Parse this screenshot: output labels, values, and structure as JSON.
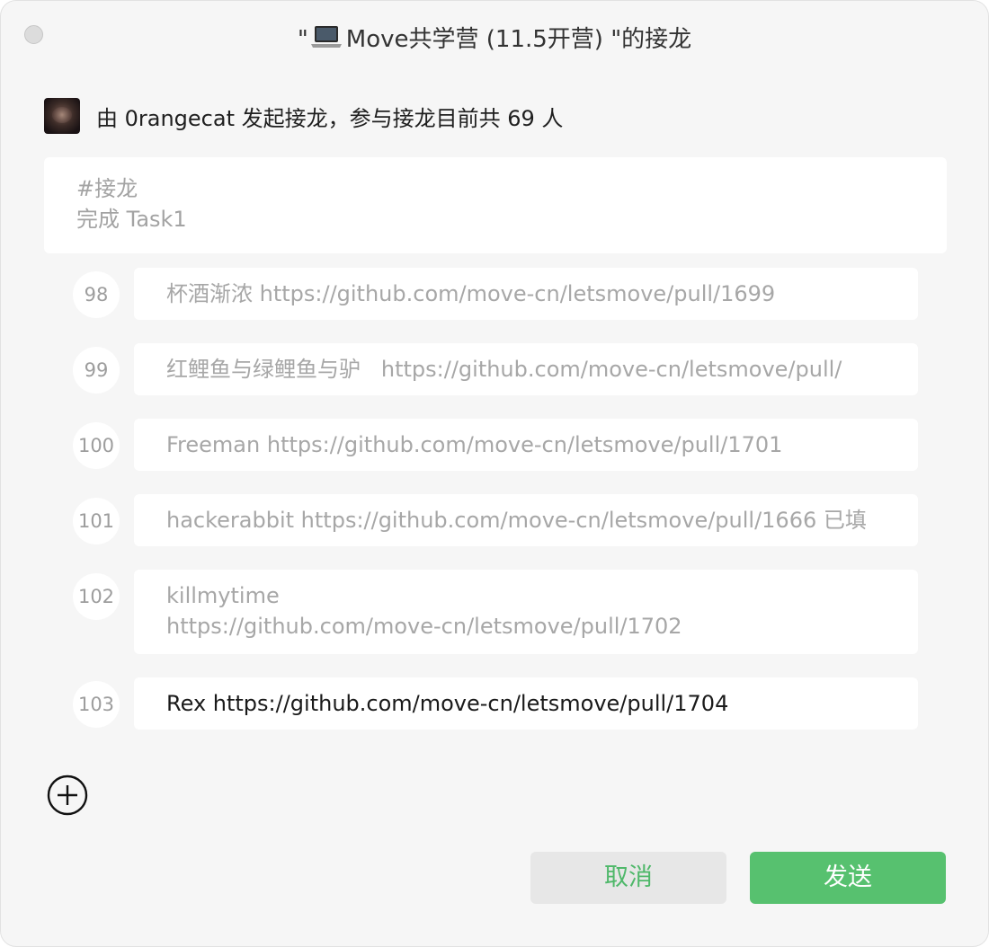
{
  "window": {
    "title_prefix": "\"",
    "title_main": "Move共学营 (11.5开营) \"的接龙"
  },
  "initiator": {
    "text": "由 0rangecat 发起接龙，参与接龙目前共 69 人"
  },
  "header_card": {
    "line1": "#接龙",
    "line2": "完成 Task1"
  },
  "entries": [
    {
      "num": "98",
      "text": "杯酒渐浓 https://github.com/move-cn/letsmove/pull/1699"
    },
    {
      "num": "99",
      "text": "红鲤鱼与绿鲤鱼与驴   https://github.com/move-cn/letsmove/pull/"
    },
    {
      "num": "100",
      "text": "Freeman https://github.com/move-cn/letsmove/pull/1701"
    },
    {
      "num": "101",
      "text": "hackerabbit https://github.com/move-cn/letsmove/pull/1666 已填"
    },
    {
      "num": "102",
      "text": "killmytime\nhttps://github.com/move-cn/letsmove/pull/1702"
    },
    {
      "num": "103",
      "text": "Rex https://github.com/move-cn/letsmove/pull/1704"
    }
  ],
  "buttons": {
    "cancel": "取消",
    "send": "发送"
  },
  "icons": {
    "close": "close-icon",
    "laptop": "laptop-icon",
    "add": "plus-circle-icon"
  },
  "colors": {
    "accent": "#57c16f",
    "window_bg": "#f6f6f6"
  }
}
